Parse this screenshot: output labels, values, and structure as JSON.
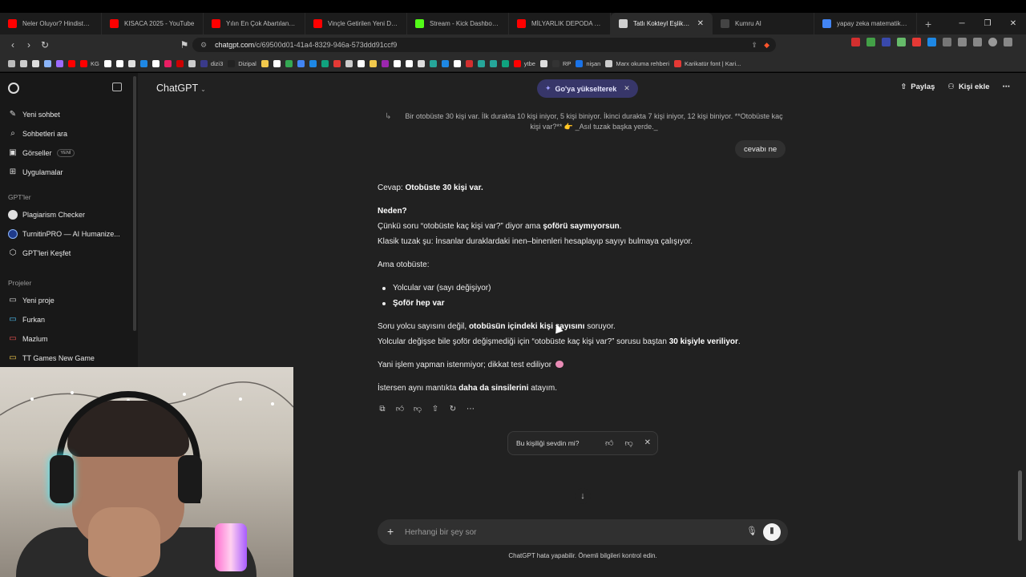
{
  "browser": {
    "tabs": [
      {
        "label": "Neler Oluyor? Hindistan B",
        "color": "#ff0000"
      },
      {
        "label": "KISACA 2025 - YouTube",
        "color": "#ff0000"
      },
      {
        "label": "Yılın En Çok Abartılan Film",
        "color": "#ff0000"
      },
      {
        "label": "Vinçle Getirilen Yeni DEVA",
        "color": "#ff0000"
      },
      {
        "label": "Stream - Kick Dashboard",
        "color": "#53fc18"
      },
      {
        "label": "MİLYARLIK DEPODA PC TO",
        "color": "#ff0000"
      },
      {
        "label": "Tatlı Kokteyl Eşlikçileri",
        "color": "#d0d0d0",
        "active": true
      },
      {
        "label": "Kumru AI",
        "color": "#444444"
      },
      {
        "label": "yapay zeka matematik sor",
        "color": "#4285f4"
      }
    ],
    "url_host": "chatgpt.com",
    "url_path": "/c/69500d01-41a4-8329-946a-573ddd91ccf9",
    "bookmarks": [
      {
        "label": "",
        "color": "#bbbbbb"
      },
      {
        "label": "",
        "color": "#cccccc"
      },
      {
        "label": "",
        "color": "#dddddd"
      },
      {
        "label": "",
        "color": "#8ab4f8"
      },
      {
        "label": "",
        "color": "#9c6bff"
      },
      {
        "label": "",
        "color": "#ff0000"
      },
      {
        "label": "KG",
        "color": "#ff0000"
      },
      {
        "label": "",
        "color": "#ffffff"
      },
      {
        "label": "",
        "color": "#ffffff"
      },
      {
        "label": "",
        "color": "#e0e0e0"
      },
      {
        "label": "",
        "color": "#1e88e5"
      },
      {
        "label": "",
        "color": "#ffffff"
      },
      {
        "label": "",
        "color": "#e91e63"
      },
      {
        "label": "",
        "color": "#cc0000"
      },
      {
        "label": "",
        "color": "#cccccc"
      },
      {
        "label": "dizi3",
        "color": "#3a3a8a"
      },
      {
        "label": "Dizipal",
        "color": "#222222"
      },
      {
        "label": "",
        "color": "#f2c94c"
      },
      {
        "label": "",
        "color": "#ffffff"
      },
      {
        "label": "",
        "color": "#34a853"
      },
      {
        "label": "",
        "color": "#4285f4"
      },
      {
        "label": "",
        "color": "#1e88e5"
      },
      {
        "label": "",
        "color": "#10a37f"
      },
      {
        "label": "",
        "color": "#e53935"
      },
      {
        "label": "",
        "color": "#cccccc"
      },
      {
        "label": "",
        "color": "#ffffff"
      },
      {
        "label": "",
        "color": "#f2c94c"
      },
      {
        "label": "",
        "color": "#9c27b0"
      },
      {
        "label": "",
        "color": "#ffffff"
      },
      {
        "label": "",
        "color": "#ffffff"
      },
      {
        "label": "",
        "color": "#dddddd"
      },
      {
        "label": "",
        "color": "#26a69a"
      },
      {
        "label": "",
        "color": "#1e88e5"
      },
      {
        "label": "",
        "color": "#ffffff"
      },
      {
        "label": "",
        "color": "#d32f2f"
      },
      {
        "label": "",
        "color": "#26a69a"
      },
      {
        "label": "",
        "color": "#26a69a"
      },
      {
        "label": "",
        "color": "#10a37f"
      },
      {
        "label": "ytbe",
        "color": "#ff0000"
      },
      {
        "label": "",
        "color": "#dddddd"
      },
      {
        "label": "RP",
        "color": "#333333"
      },
      {
        "label": "nişan",
        "color": "#1a73e8"
      },
      {
        "label": "Marx okuma rehberi",
        "color": "#cccccc"
      },
      {
        "label": "Karikatür font | Kari...",
        "color": "#e53935"
      }
    ]
  },
  "sidebar": {
    "top_items": [
      {
        "label": "Yeni sohbet",
        "icon": "edit-icon"
      },
      {
        "label": "Sohbetleri ara",
        "icon": "search-icon"
      },
      {
        "label": "Görseller",
        "icon": "image-icon",
        "badge": "YENİ"
      },
      {
        "label": "Uygulamalar",
        "icon": "grid-icon"
      }
    ],
    "gpts_heading": "GPT'ler",
    "gpts": [
      {
        "label": "Plagiarism Checker",
        "color": "#e0e0e0"
      },
      {
        "label": "TurnitinPRO — AI Humanize...",
        "color": "#1e3a8a"
      },
      {
        "label": "GPT'leri Keşfet",
        "color": "#cccccc"
      }
    ],
    "projects_heading": "Projeler",
    "projects": [
      {
        "label": "Yeni proje",
        "color": "#dddddd"
      },
      {
        "label": "Furkan",
        "color": "#4fc3f7"
      },
      {
        "label": "Mazlum",
        "color": "#ef5350"
      },
      {
        "label": "TT Games New Game",
        "color": "#f2c94c"
      }
    ]
  },
  "header": {
    "model": "ChatGPT",
    "upgrade": "Go'ya yükselterek",
    "share": "Paylaş",
    "add_person": "Kişi ekle"
  },
  "chat": {
    "quoted": "Bir otobüste 30 kişi var. İlk durakta 10 kişi iniyor, 5 kişi biniyor. İkinci durakta 7 kişi iniyor, 12 kişi biniyor. **Otobüste kaç kişi var?** 👉 _Asıl tuzak başka yerde._",
    "user_message": "cevabı ne",
    "reply": {
      "answer_prefix": "Cevap: ",
      "answer_bold": "Otobüste 30 kişi var.",
      "why": "Neden?",
      "l1_a": "Çünkü soru “otobüste kaç kişi var?” diyor ama ",
      "l1_b": "şoförü saymıyorsun",
      "l1_c": ".",
      "l2": "Klasik tuzak şu: İnsanlar duraklardaki inen–binenleri hesaplayıp sayıyı bulmaya çalışıyor.",
      "but": "Ama otobüste:",
      "bullet1": "Yolcular var (sayı değişiyor)",
      "bullet2": "Şoför hep var",
      "l3_a": "Soru yolcu sayısını değil, ",
      "l3_b": "otobüsün içindeki kişi sayısını",
      "l3_c": " soruyor.",
      "l4_a": "Yolcular değişse bile şoför değişmediği için “otobüste kaç kişi var?” sorusu baştan ",
      "l4_b": "30 kişiyle veriliyor",
      "l4_c": ".",
      "l5": "Yani işlem yapman istenmiyor; dikkat test ediliyor",
      "l6_a": "İstersen aynı mantıkta ",
      "l6_b": "daha da sinsilerini",
      "l6_c": " atayım."
    },
    "feedback_question": "Bu kişiliği sevdin mi?",
    "composer_placeholder": "Herhangi bir şey sor",
    "disclaimer": "ChatGPT hata yapabilir. Önemli bilgileri kontrol edin."
  }
}
